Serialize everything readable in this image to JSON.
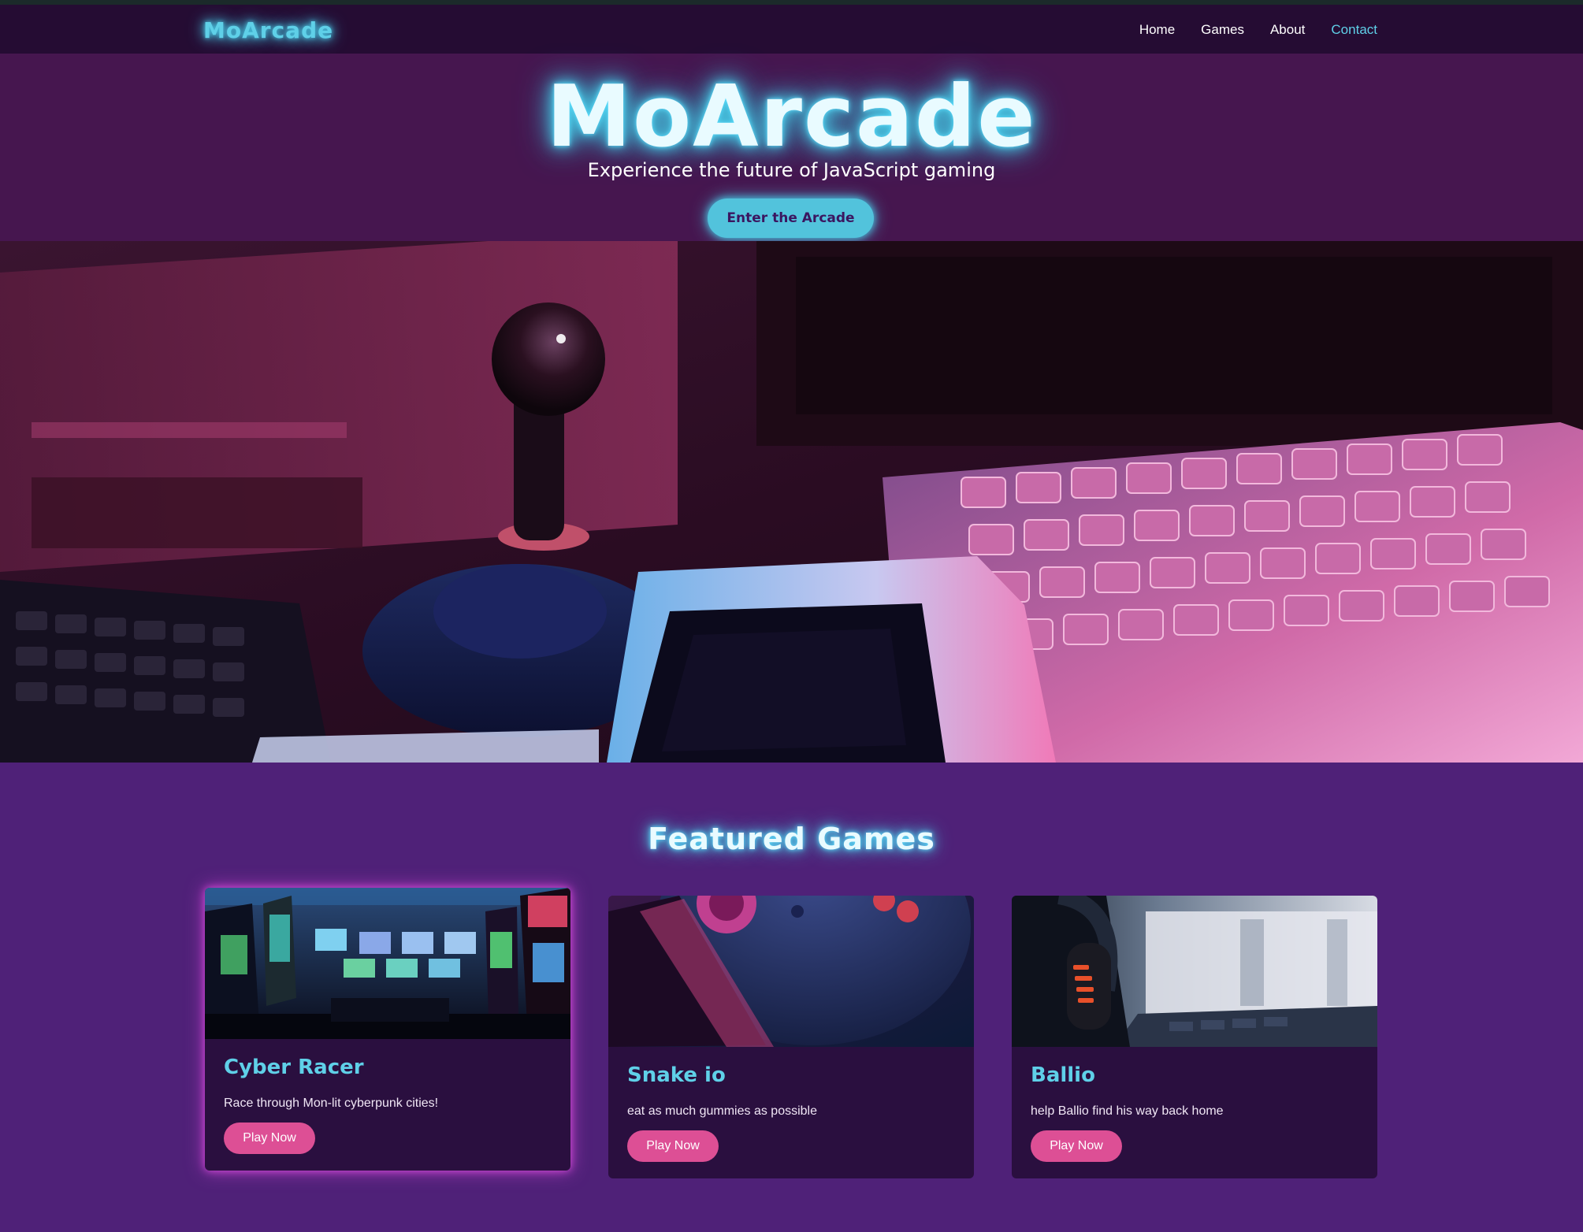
{
  "nav": {
    "logo": "MoArcade",
    "links": [
      {
        "label": "Home",
        "active": false
      },
      {
        "label": "Games",
        "active": false
      },
      {
        "label": "About",
        "active": false
      },
      {
        "label": "Contact",
        "active": true
      }
    ]
  },
  "hero": {
    "title": "MoArcade",
    "subtitle": "Experience the future of JavaScript gaming",
    "cta_label": "Enter the Arcade"
  },
  "featured": {
    "title": "Featured Games",
    "games": [
      {
        "title": "Cyber Racer",
        "description": "Race through Mon-lit cyberpunk cities!",
        "button_label": "Play Now",
        "highlighted": true
      },
      {
        "title": "Snake io",
        "description": "eat as much gummies as possible",
        "button_label": "Play Now",
        "highlighted": false
      },
      {
        "title": "Ballio",
        "description": "help Ballio find his way back home",
        "button_label": "Play Now",
        "highlighted": false
      }
    ]
  },
  "colors": {
    "accent_cyan": "#5fd0e8",
    "accent_pink": "#dd4f95",
    "nav_bg": "#250c33",
    "hero_bg": "#46164f",
    "page_bg": "#4f2178",
    "card_bg": "#2a0f3f"
  }
}
